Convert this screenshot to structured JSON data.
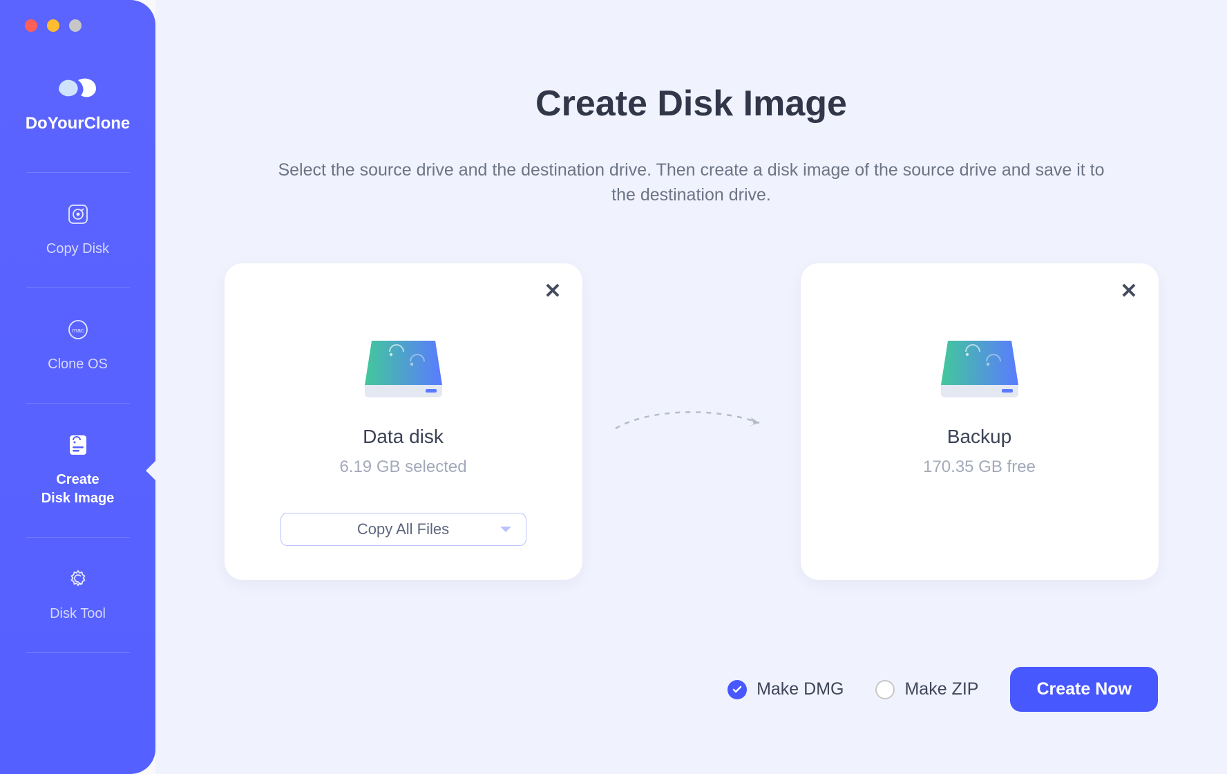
{
  "app": {
    "name": "DoYourClone"
  },
  "sidebar": {
    "items": [
      {
        "label": "Copy Disk"
      },
      {
        "label": "Clone OS"
      },
      {
        "label": "Create\nDisk Image"
      },
      {
        "label": "Disk Tool"
      }
    ],
    "active_index": 2
  },
  "page": {
    "title": "Create Disk Image",
    "description": "Select the source drive and the destination drive. Then create a disk image of the source drive and save it to the destination drive."
  },
  "source": {
    "name": "Data disk",
    "subtitle": "6.19 GB selected",
    "dropdown_label": "Copy All Files"
  },
  "destination": {
    "name": "Backup",
    "subtitle": "170.35 GB free"
  },
  "options": {
    "dmg_label": "Make DMG",
    "zip_label": "Make ZIP",
    "selected": "dmg"
  },
  "actions": {
    "create_label": "Create Now"
  },
  "colors": {
    "accent": "#4858ff",
    "sidebar": "#5460ff"
  }
}
